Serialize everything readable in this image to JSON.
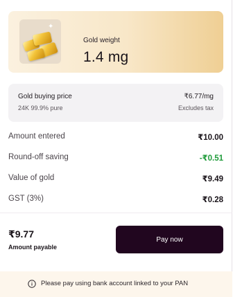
{
  "gold_card": {
    "label": "Gold weight",
    "value": "1.4 mg",
    "icon": "gold-bars-icon"
  },
  "price_card": {
    "title": "Gold buying price",
    "purity": "24K 99.9% pure",
    "price": "₹6.77/mg",
    "tax_note": "Excludes tax"
  },
  "breakdown": [
    {
      "label": "Amount entered",
      "value": "₹10.00",
      "color": "#1a141a"
    },
    {
      "label": "Round-off saving",
      "value": "-₹0.51",
      "color": "#1f9b3a"
    },
    {
      "label": "Value of gold",
      "value": "₹9.49",
      "color": "#1a141a"
    },
    {
      "label": "GST (3%)",
      "value": "₹0.28",
      "color": "#1a141a"
    }
  ],
  "payable": {
    "amount": "₹9.77",
    "label": "Amount payable"
  },
  "pay_button": {
    "label": "Pay now",
    "color": "#21061f"
  },
  "notice": {
    "icon": "info-icon",
    "text": "Please pay using bank account linked to your PAN"
  }
}
